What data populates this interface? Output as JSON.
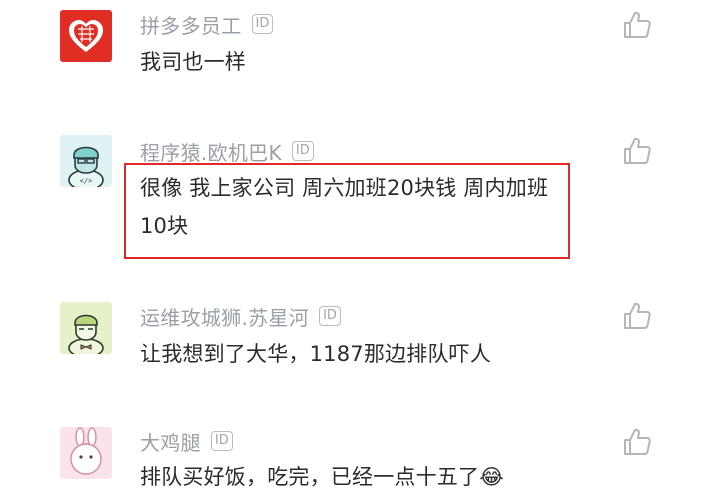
{
  "comments": [
    {
      "name": "拼多多员工",
      "badge": "ID",
      "text": "我司也一样",
      "avatar": "pinduoduo-logo-avatar"
    },
    {
      "name": "程序猿.欧机巴K",
      "badge": "ID",
      "text": "很像 我上家公司 周六加班20块钱 周内加班10块",
      "avatar": "programmer-avatar"
    },
    {
      "name": "运维攻城狮.苏星河",
      "badge": "ID",
      "text": "让我想到了大华，1187那边排队吓人",
      "avatar": "ops-engineer-avatar"
    },
    {
      "name": "大鸡腿",
      "badge": "ID",
      "text": "排队买好饭，吃完，已经一点十五了😂",
      "avatar": "rabbit-avatar"
    }
  ],
  "like_icon": "thumbs-up-outline-icon",
  "colors": {
    "highlight_border": "#e02a2a",
    "name_text": "#9aa0a8",
    "body_text": "#2b2b2b",
    "pdd_red": "#e02e24"
  }
}
